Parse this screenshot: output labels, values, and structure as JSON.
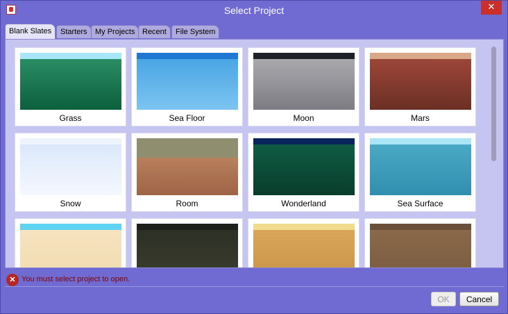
{
  "window": {
    "title": "Select Project",
    "close_symbol": "✕"
  },
  "tabs": [
    {
      "label": "Blank Slates",
      "active": true
    },
    {
      "label": "Starters",
      "active": false
    },
    {
      "label": "My Projects",
      "active": false
    },
    {
      "label": "Recent",
      "active": false
    },
    {
      "label": "File System",
      "active": false
    }
  ],
  "templates": [
    {
      "label": "Grass",
      "sky": "#a7e7f7",
      "ground": [
        "#2a8d64",
        "#0c5f3c"
      ]
    },
    {
      "label": "Sea Floor",
      "sky": "#1f78d1",
      "ground": [
        "#4aa6e4",
        "#7cc4f1"
      ]
    },
    {
      "label": "Moon",
      "sky": "#1e2128",
      "ground": [
        "#a9a9ad",
        "#7d7c83"
      ]
    },
    {
      "label": "Mars",
      "sky": "#d9a888",
      "ground": [
        "#9b4638",
        "#6c2f24"
      ]
    },
    {
      "label": "Snow",
      "sky": "#eef4fc",
      "ground": [
        "#dbe8fb",
        "#f4f8fe"
      ]
    },
    {
      "label": "Room",
      "sky": "#8f8f6f",
      "ground": [
        "#b8805b",
        "#9e6446"
      ]
    },
    {
      "label": "Wonderland",
      "sky": "#09245a",
      "ground": [
        "#0f5c43",
        "#093d2c"
      ]
    },
    {
      "label": "Sea Surface",
      "sky": "#a9e5f4",
      "ground": [
        "#4aa9c4",
        "#2f8fae"
      ]
    },
    {
      "label": "",
      "sky": "#5fd3f2",
      "ground": [
        "#f6e2bd",
        "#f1dcb2"
      ]
    },
    {
      "label": "",
      "sky": "#1c1f1a",
      "ground": [
        "#2c3025",
        "#3b3d2d"
      ]
    },
    {
      "label": "",
      "sky": "#f0dc8c",
      "ground": [
        "#d9a65a",
        "#c99346"
      ]
    },
    {
      "label": "",
      "sky": "#6a5038",
      "ground": [
        "#8a6849",
        "#7a5b40"
      ]
    }
  ],
  "status": {
    "icon": "error-icon",
    "icon_glyph": "✕",
    "message": "You must select project to open."
  },
  "buttons": {
    "ok_label": "OK",
    "cancel_label": "Cancel"
  }
}
